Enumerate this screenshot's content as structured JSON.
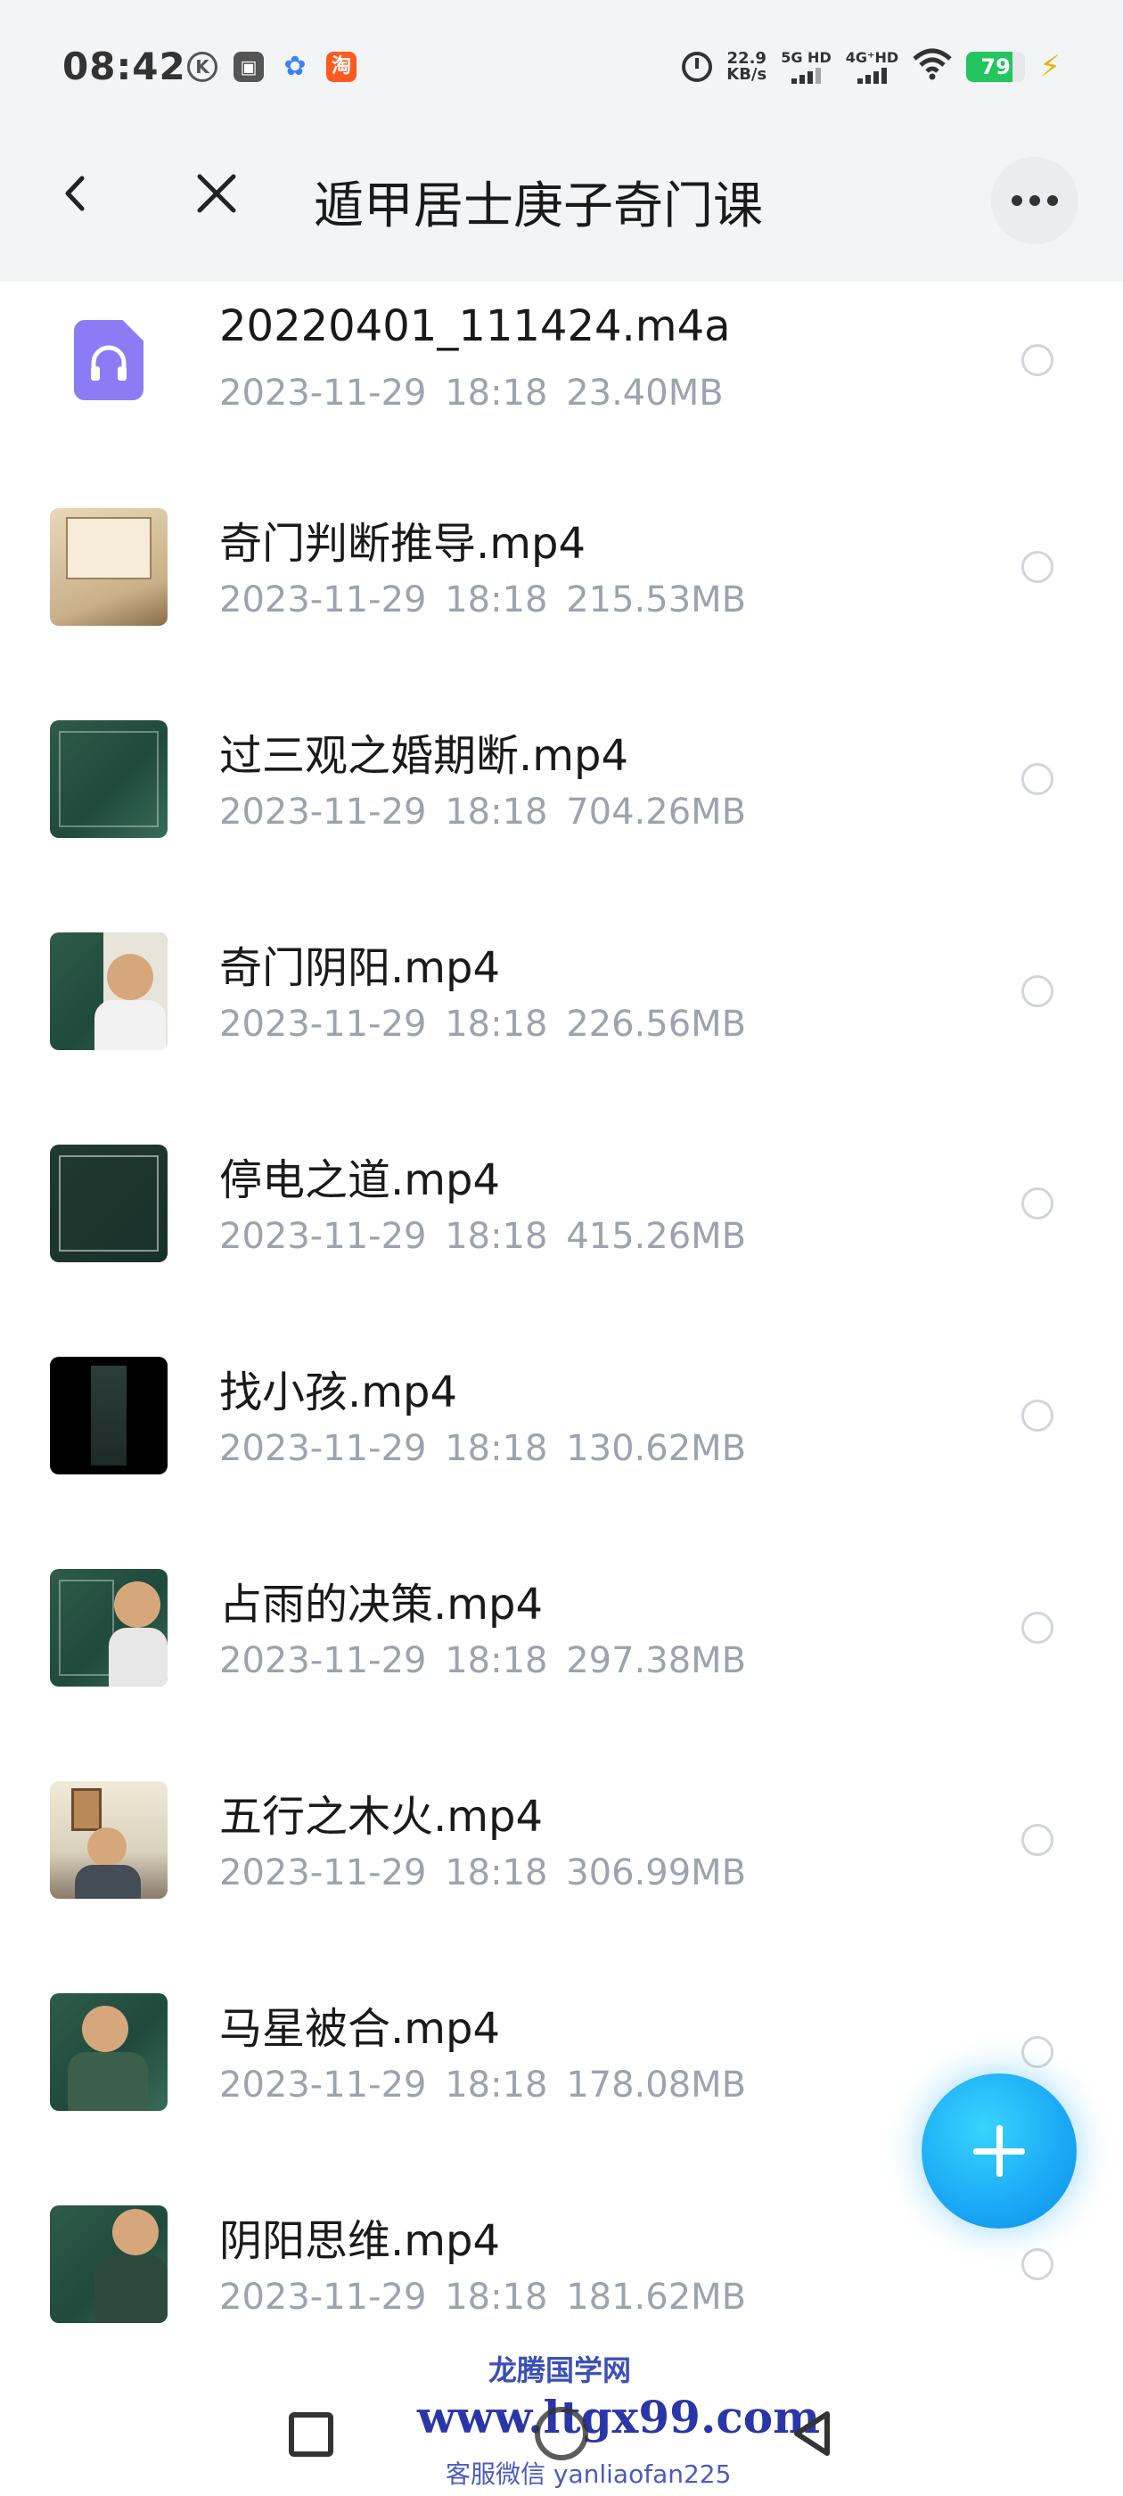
{
  "status_bar": {
    "time": "08:42",
    "app_icons": [
      "K",
      "▣",
      "✿",
      "淘"
    ],
    "net_speed_value": "22.9",
    "net_speed_unit": "KB/s",
    "signal1_label": "5G HD",
    "signal2_label": "4G⁺HD",
    "battery_level": 79,
    "battery_text": "79"
  },
  "header": {
    "title": "遁甲居士庚子奇门课"
  },
  "files": [
    {
      "name": "20220401_111424.m4a",
      "date": "2023-11-29",
      "time": "18:18",
      "size": "23.40MB",
      "thumb": "audio"
    },
    {
      "name": "奇门判断推导.mp4",
      "date": "2023-11-29",
      "time": "18:18",
      "size": "215.53MB",
      "thumb": "paper"
    },
    {
      "name": "过三观之婚期断.mp4",
      "date": "2023-11-29",
      "time": "18:18",
      "size": "704.26MB",
      "thumb": "chalk"
    },
    {
      "name": "奇门阴阳.mp4",
      "date": "2023-11-29",
      "time": "18:18",
      "size": "226.56MB",
      "thumb": "chalk-person"
    },
    {
      "name": "停电之道.mp4",
      "date": "2023-11-29",
      "time": "18:18",
      "size": "415.26MB",
      "thumb": "chalk-dark"
    },
    {
      "name": "找小孩.mp4",
      "date": "2023-11-29",
      "time": "18:18",
      "size": "130.62MB",
      "thumb": "black"
    },
    {
      "name": "占雨的决策.mp4",
      "date": "2023-11-29",
      "time": "18:18",
      "size": "297.38MB",
      "thumb": "chalk-person"
    },
    {
      "name": "五行之木火.mp4",
      "date": "2023-11-29",
      "time": "18:18",
      "size": "306.99MB",
      "thumb": "room"
    },
    {
      "name": "马星被合.mp4",
      "date": "2023-11-29",
      "time": "18:18",
      "size": "178.08MB",
      "thumb": "chalk-person"
    },
    {
      "name": "阴阳思维.mp4",
      "date": "2023-11-29",
      "time": "18:18",
      "size": "181.62MB",
      "thumb": "chalk-person"
    }
  ],
  "watermark": {
    "line1": "龙腾国学网",
    "line2": "www.ltgx99.com",
    "line3": "客服微信 yanliaofan225"
  },
  "icons": {
    "back": "chevron-left-icon",
    "close": "close-icon",
    "more": "more-horizontal-icon",
    "fab": "plus-icon"
  }
}
